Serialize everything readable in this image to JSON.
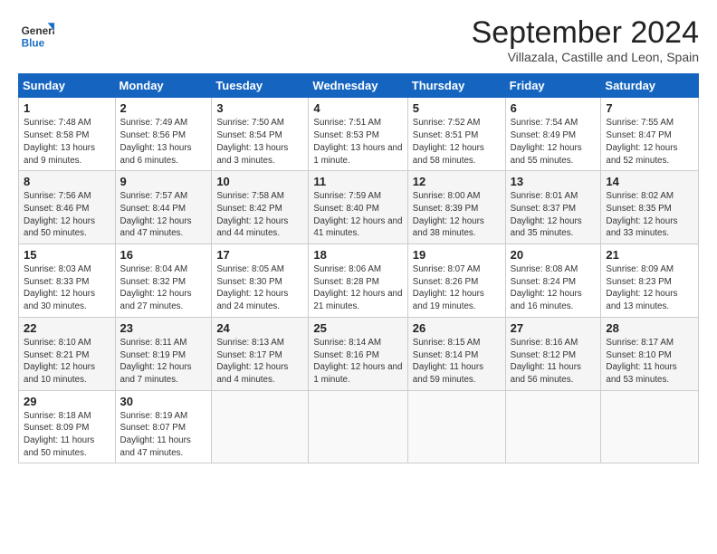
{
  "header": {
    "logo_general": "General",
    "logo_blue": "Blue",
    "month_title": "September 2024",
    "location": "Villazala, Castille and Leon, Spain"
  },
  "days_of_week": [
    "Sunday",
    "Monday",
    "Tuesday",
    "Wednesday",
    "Thursday",
    "Friday",
    "Saturday"
  ],
  "weeks": [
    [
      {
        "day": "1",
        "sunrise": "Sunrise: 7:48 AM",
        "sunset": "Sunset: 8:58 PM",
        "daylight": "Daylight: 13 hours and 9 minutes."
      },
      {
        "day": "2",
        "sunrise": "Sunrise: 7:49 AM",
        "sunset": "Sunset: 8:56 PM",
        "daylight": "Daylight: 13 hours and 6 minutes."
      },
      {
        "day": "3",
        "sunrise": "Sunrise: 7:50 AM",
        "sunset": "Sunset: 8:54 PM",
        "daylight": "Daylight: 13 hours and 3 minutes."
      },
      {
        "day": "4",
        "sunrise": "Sunrise: 7:51 AM",
        "sunset": "Sunset: 8:53 PM",
        "daylight": "Daylight: 13 hours and 1 minute."
      },
      {
        "day": "5",
        "sunrise": "Sunrise: 7:52 AM",
        "sunset": "Sunset: 8:51 PM",
        "daylight": "Daylight: 12 hours and 58 minutes."
      },
      {
        "day": "6",
        "sunrise": "Sunrise: 7:54 AM",
        "sunset": "Sunset: 8:49 PM",
        "daylight": "Daylight: 12 hours and 55 minutes."
      },
      {
        "day": "7",
        "sunrise": "Sunrise: 7:55 AM",
        "sunset": "Sunset: 8:47 PM",
        "daylight": "Daylight: 12 hours and 52 minutes."
      }
    ],
    [
      {
        "day": "8",
        "sunrise": "Sunrise: 7:56 AM",
        "sunset": "Sunset: 8:46 PM",
        "daylight": "Daylight: 12 hours and 50 minutes."
      },
      {
        "day": "9",
        "sunrise": "Sunrise: 7:57 AM",
        "sunset": "Sunset: 8:44 PM",
        "daylight": "Daylight: 12 hours and 47 minutes."
      },
      {
        "day": "10",
        "sunrise": "Sunrise: 7:58 AM",
        "sunset": "Sunset: 8:42 PM",
        "daylight": "Daylight: 12 hours and 44 minutes."
      },
      {
        "day": "11",
        "sunrise": "Sunrise: 7:59 AM",
        "sunset": "Sunset: 8:40 PM",
        "daylight": "Daylight: 12 hours and 41 minutes."
      },
      {
        "day": "12",
        "sunrise": "Sunrise: 8:00 AM",
        "sunset": "Sunset: 8:39 PM",
        "daylight": "Daylight: 12 hours and 38 minutes."
      },
      {
        "day": "13",
        "sunrise": "Sunrise: 8:01 AM",
        "sunset": "Sunset: 8:37 PM",
        "daylight": "Daylight: 12 hours and 35 minutes."
      },
      {
        "day": "14",
        "sunrise": "Sunrise: 8:02 AM",
        "sunset": "Sunset: 8:35 PM",
        "daylight": "Daylight: 12 hours and 33 minutes."
      }
    ],
    [
      {
        "day": "15",
        "sunrise": "Sunrise: 8:03 AM",
        "sunset": "Sunset: 8:33 PM",
        "daylight": "Daylight: 12 hours and 30 minutes."
      },
      {
        "day": "16",
        "sunrise": "Sunrise: 8:04 AM",
        "sunset": "Sunset: 8:32 PM",
        "daylight": "Daylight: 12 hours and 27 minutes."
      },
      {
        "day": "17",
        "sunrise": "Sunrise: 8:05 AM",
        "sunset": "Sunset: 8:30 PM",
        "daylight": "Daylight: 12 hours and 24 minutes."
      },
      {
        "day": "18",
        "sunrise": "Sunrise: 8:06 AM",
        "sunset": "Sunset: 8:28 PM",
        "daylight": "Daylight: 12 hours and 21 minutes."
      },
      {
        "day": "19",
        "sunrise": "Sunrise: 8:07 AM",
        "sunset": "Sunset: 8:26 PM",
        "daylight": "Daylight: 12 hours and 19 minutes."
      },
      {
        "day": "20",
        "sunrise": "Sunrise: 8:08 AM",
        "sunset": "Sunset: 8:24 PM",
        "daylight": "Daylight: 12 hours and 16 minutes."
      },
      {
        "day": "21",
        "sunrise": "Sunrise: 8:09 AM",
        "sunset": "Sunset: 8:23 PM",
        "daylight": "Daylight: 12 hours and 13 minutes."
      }
    ],
    [
      {
        "day": "22",
        "sunrise": "Sunrise: 8:10 AM",
        "sunset": "Sunset: 8:21 PM",
        "daylight": "Daylight: 12 hours and 10 minutes."
      },
      {
        "day": "23",
        "sunrise": "Sunrise: 8:11 AM",
        "sunset": "Sunset: 8:19 PM",
        "daylight": "Daylight: 12 hours and 7 minutes."
      },
      {
        "day": "24",
        "sunrise": "Sunrise: 8:13 AM",
        "sunset": "Sunset: 8:17 PM",
        "daylight": "Daylight: 12 hours and 4 minutes."
      },
      {
        "day": "25",
        "sunrise": "Sunrise: 8:14 AM",
        "sunset": "Sunset: 8:16 PM",
        "daylight": "Daylight: 12 hours and 1 minute."
      },
      {
        "day": "26",
        "sunrise": "Sunrise: 8:15 AM",
        "sunset": "Sunset: 8:14 PM",
        "daylight": "Daylight: 11 hours and 59 minutes."
      },
      {
        "day": "27",
        "sunrise": "Sunrise: 8:16 AM",
        "sunset": "Sunset: 8:12 PM",
        "daylight": "Daylight: 11 hours and 56 minutes."
      },
      {
        "day": "28",
        "sunrise": "Sunrise: 8:17 AM",
        "sunset": "Sunset: 8:10 PM",
        "daylight": "Daylight: 11 hours and 53 minutes."
      }
    ],
    [
      {
        "day": "29",
        "sunrise": "Sunrise: 8:18 AM",
        "sunset": "Sunset: 8:09 PM",
        "daylight": "Daylight: 11 hours and 50 minutes."
      },
      {
        "day": "30",
        "sunrise": "Sunrise: 8:19 AM",
        "sunset": "Sunset: 8:07 PM",
        "daylight": "Daylight: 11 hours and 47 minutes."
      },
      null,
      null,
      null,
      null,
      null
    ]
  ]
}
